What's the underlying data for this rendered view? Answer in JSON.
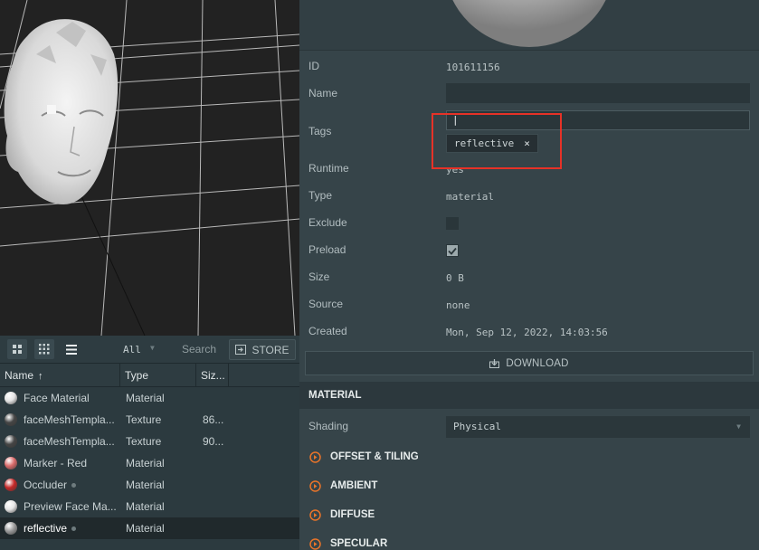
{
  "asset_toolbar": {
    "filter_value": "All",
    "search_placeholder": "Search",
    "store_label": "STORE"
  },
  "asset_table": {
    "columns": [
      "Name",
      "Type",
      "Siz..."
    ],
    "rows": [
      {
        "name": "Face Material",
        "type": "Material",
        "size": "",
        "thumb_color": "#e4e4e4"
      },
      {
        "name": "faceMeshTempla...",
        "type": "Texture",
        "size": "86...",
        "thumb_color": "#454545"
      },
      {
        "name": "faceMeshTempla...",
        "type": "Texture",
        "size": "90...",
        "thumb_color": "#454545"
      },
      {
        "name": "Marker - Red",
        "type": "Material",
        "size": "",
        "thumb_color": "#d96a6a"
      },
      {
        "name": "Occluder",
        "type": "Material",
        "size": "",
        "thumb_color": "#c62828"
      },
      {
        "name": "Preview Face Ma...",
        "type": "Material",
        "size": "",
        "thumb_color": "#e6e6e6"
      },
      {
        "name": "reflective",
        "type": "Material",
        "size": "",
        "thumb_color": "#9a9a9a"
      }
    ]
  },
  "inspector": {
    "id_label": "ID",
    "id_value": "101611156",
    "name_label": "Name",
    "name_value": "",
    "tags_label": "Tags",
    "tags_input_value": "|",
    "tag_chip": "reflective",
    "tag_remove": "×",
    "runtime_label": "Runtime",
    "runtime_value": "yes",
    "type_label": "Type",
    "type_value": "material",
    "exclude_label": "Exclude",
    "exclude_checked": false,
    "preload_label": "Preload",
    "preload_checked": true,
    "size_label": "Size",
    "size_value": "0 B",
    "source_label": "Source",
    "source_value": "none",
    "created_label": "Created",
    "created_value": "Mon, Sep 12, 2022, 14:03:56",
    "download_label": "DOWNLOAD",
    "material_header": "MATERIAL",
    "shading_label": "Shading",
    "shading_value": "Physical",
    "sections": [
      "OFFSET & TILING",
      "AMBIENT",
      "DIFFUSE",
      "SPECULAR"
    ]
  },
  "colors": {
    "accent": "#e8742a",
    "highlight": "#e63227"
  }
}
